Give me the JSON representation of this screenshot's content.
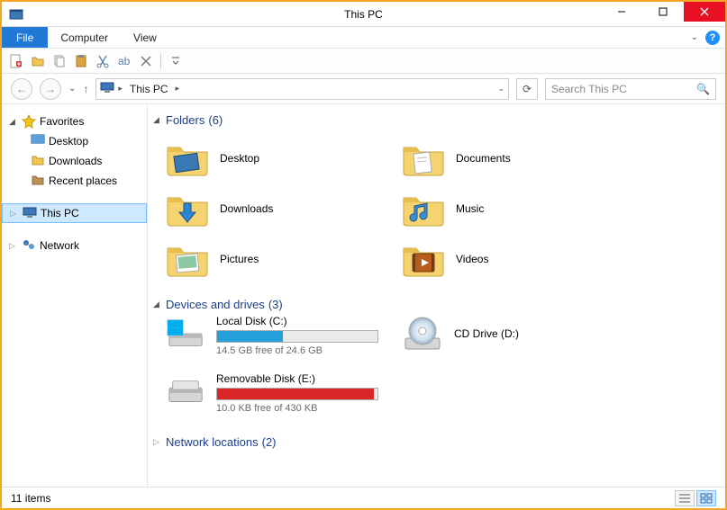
{
  "window": {
    "title": "This PC"
  },
  "ribbon": {
    "file": "File",
    "tabs": [
      "Computer",
      "View"
    ]
  },
  "nav": {
    "breadcrumb": [
      "This PC"
    ]
  },
  "search": {
    "placeholder": "Search This PC"
  },
  "sidebar": {
    "favorites": {
      "label": "Favorites",
      "items": [
        "Desktop",
        "Downloads",
        "Recent places"
      ]
    },
    "thispc": {
      "label": "This PC"
    },
    "network": {
      "label": "Network"
    }
  },
  "sections": {
    "folders": {
      "label": "Folders",
      "count": "(6)",
      "items": [
        "Desktop",
        "Documents",
        "Downloads",
        "Music",
        "Pictures",
        "Videos"
      ]
    },
    "devices": {
      "label": "Devices and drives",
      "count": "(3)",
      "items": [
        {
          "name": "Local Disk (C:)",
          "free": "14.5 GB free of 24.6 GB",
          "fill_percent": 41,
          "fill_color": "#26a0da"
        },
        {
          "name": "CD Drive (D:)",
          "free": "",
          "fill_percent": 0,
          "fill_color": ""
        },
        {
          "name": "Removable Disk (E:)",
          "free": "10.0 KB free of 430 KB",
          "fill_percent": 98,
          "fill_color": "#da2626"
        }
      ]
    },
    "network": {
      "label": "Network locations",
      "count": "(2)"
    }
  },
  "statusbar": {
    "items": "11 items"
  }
}
